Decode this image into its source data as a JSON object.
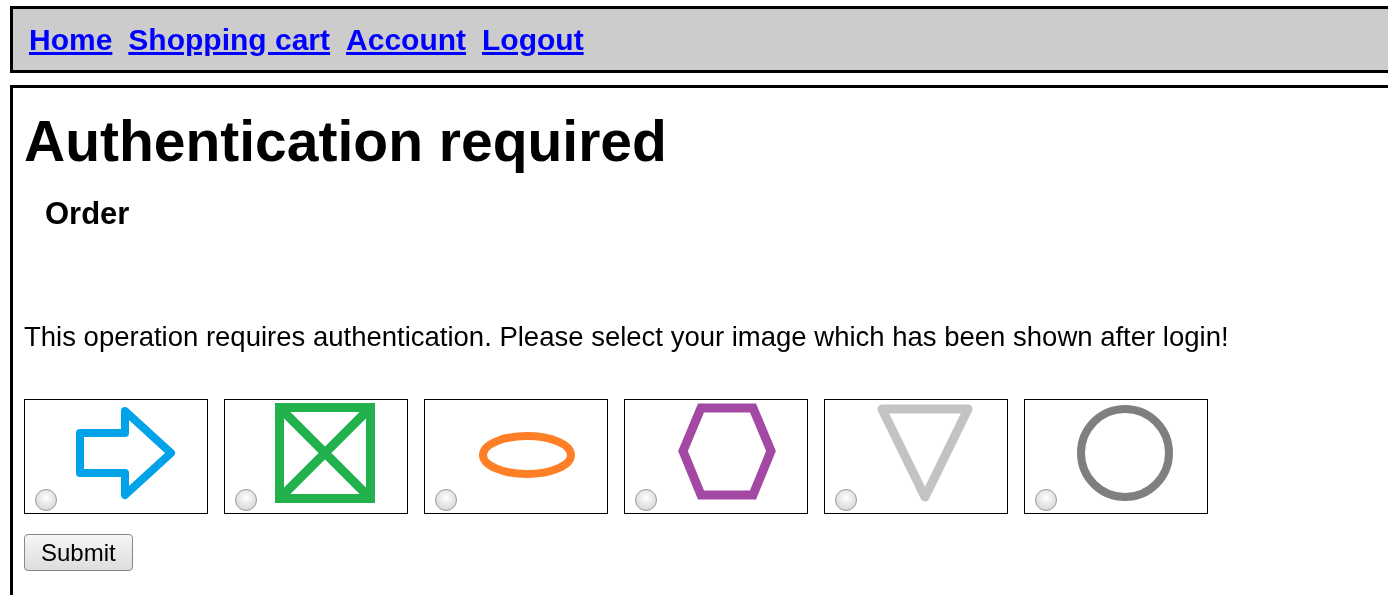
{
  "nav_links": [
    "Home",
    "Shopping cart",
    "Account",
    "Logout"
  ],
  "heading": "Authentication required",
  "subheading": "Order",
  "message": "This operation requires authentication. Please select your image which has been shown after login!",
  "images": [
    {
      "kind": "arrow",
      "color": "#00a2e8",
      "selected": false
    },
    {
      "kind": "crossed-square",
      "color": "#22b14c",
      "selected": false
    },
    {
      "kind": "ellipse",
      "color": "#ff7f27",
      "selected": false
    },
    {
      "kind": "hexagon",
      "color": "#a349a4",
      "selected": false
    },
    {
      "kind": "triangle",
      "color": "#c3c3c3",
      "selected": false
    },
    {
      "kind": "circle",
      "color": "#7f7f7f",
      "selected": false
    }
  ],
  "submit": "Submit"
}
